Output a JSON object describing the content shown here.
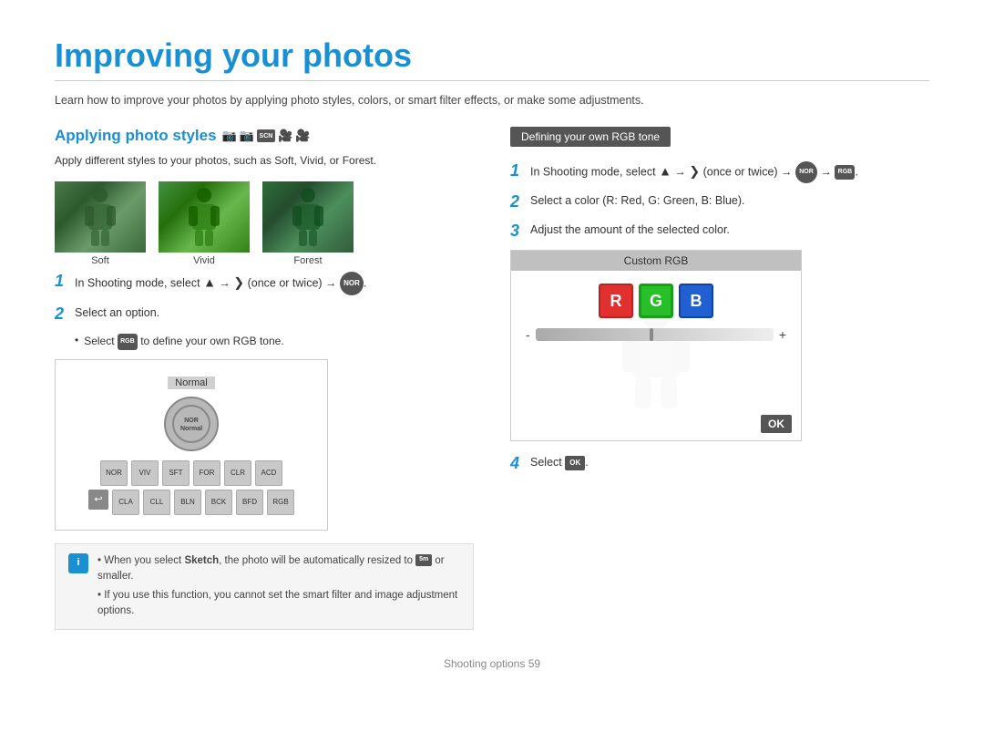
{
  "page": {
    "title": "Improving your photos",
    "subtitle": "Learn how to improve your photos by applying photo styles, colors, or smart filter effects, or make some adjustments.",
    "footer": "Shooting options  59"
  },
  "left": {
    "section_title": "Applying photo styles",
    "section_desc": "Apply different styles to your photos, such as Soft, Vivid, or Forest.",
    "photos": [
      {
        "label": "Soft"
      },
      {
        "label": "Vivid"
      },
      {
        "label": "Forest"
      }
    ],
    "steps": [
      {
        "num": "1",
        "text": "In Shooting mode, select  →  (once or twice) → ."
      },
      {
        "num": "2",
        "text": "Select an option."
      }
    ],
    "bullet": "Select  to define your own RGB tone.",
    "menu_label": "Normal",
    "note_items": [
      "When you select Sketch, the photo will be automatically resized to  or smaller.",
      "If you use this function, you cannot set the smart filter and image adjustment options."
    ]
  },
  "right": {
    "badge": "Defining your own RGB tone",
    "steps": [
      {
        "num": "1",
        "text": "In Shooting mode, select  →  (once or twice) →   → ."
      },
      {
        "num": "2",
        "text": "Select a color (R: Red, G: Green, B: Blue)."
      },
      {
        "num": "3",
        "text": "Adjust the amount of the selected color."
      },
      {
        "num": "4",
        "text": "Select OK."
      }
    ],
    "rgb_panel": {
      "header": "Custom RGB",
      "r_label": "R",
      "g_label": "G",
      "b_label": "B",
      "minus": "-",
      "plus": "+",
      "ok": "OK"
    }
  }
}
